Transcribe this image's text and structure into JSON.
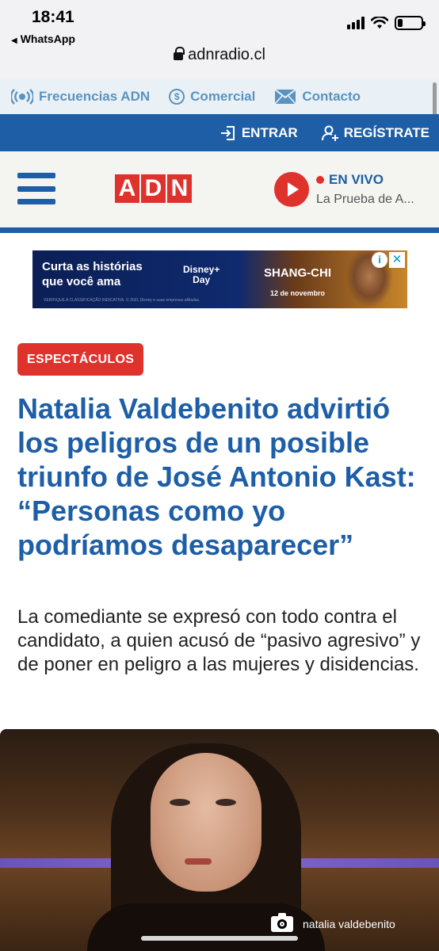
{
  "status_bar": {
    "time": "18:41",
    "back_app": "WhatsApp",
    "battery_level": 0.2
  },
  "browser": {
    "url": "adnradio.cl"
  },
  "utility_nav": {
    "items": [
      {
        "label": "Frecuencias ADN",
        "icon": "radio-waves-icon"
      },
      {
        "label": "Comercial",
        "icon": "dollar-coin-icon"
      },
      {
        "label": "Contacto",
        "icon": "envelope-icon"
      }
    ]
  },
  "account_bar": {
    "login_label": "ENTRAR",
    "register_label": "REGÍSTRATE"
  },
  "header": {
    "logo_letters": [
      "A",
      "D",
      "N"
    ],
    "live_label": "EN VIVO",
    "live_show": "La Prueba de A..."
  },
  "ad": {
    "headline_line1": "Curta as histórias",
    "headline_line2": "que você ama",
    "brand_line1": "Disney+",
    "brand_line2": "Day",
    "movie_title": "SHANG-CHI",
    "date": "12 de novembro",
    "fine_print": "VERIFIQUE A CLASSIFICAÇÃO INDICATIVA. © 2021 Disney e suas empresas afiliadas."
  },
  "article": {
    "section": "ESPECTÁCULOS",
    "headline": "Natalia Valdebenito advirtió los peligros de un posible triunfo de José Antonio Kast: “Personas como yo podríamos desaparecer”",
    "summary": "La comediante se expresó con todo contra el candidato, a quien acusó de “pasivo agresivo” y de poner en peligro a las mujeres y disidencias.",
    "photo_caption": "natalia valdebenito"
  },
  "colors": {
    "brand_blue": "#1d5ea6",
    "brand_red": "#e0322d",
    "utility_link": "#5a93c0"
  }
}
